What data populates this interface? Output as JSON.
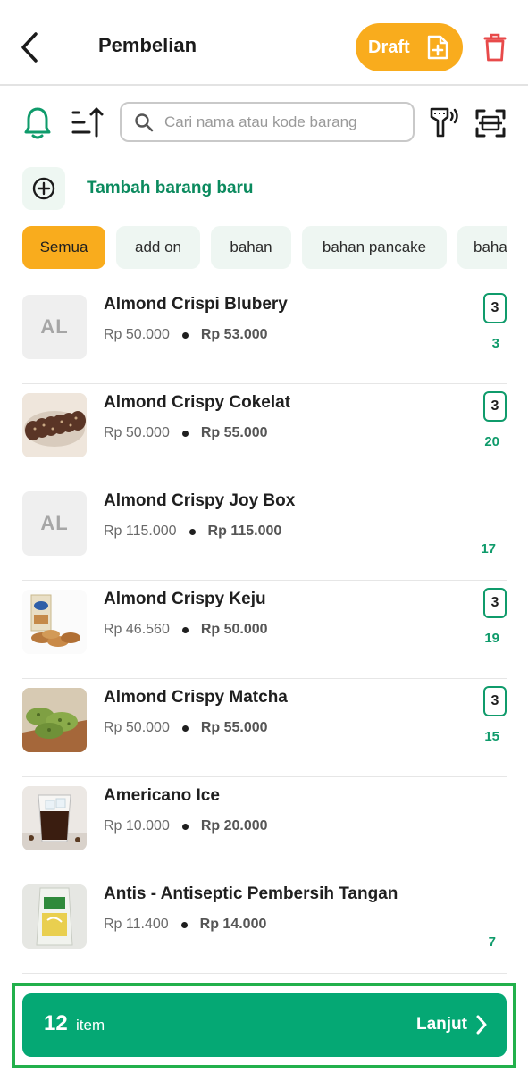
{
  "header": {
    "title": "Pembelian",
    "draft_label": "Draft",
    "accent": "#f9ac1d",
    "danger": "#e84a4a"
  },
  "toolbar": {
    "search_placeholder": "Cari nama atau kode barang"
  },
  "add_item": {
    "label": "Tambah barang baru"
  },
  "categories": [
    {
      "label": "Semua",
      "active": true
    },
    {
      "label": "add on",
      "active": false
    },
    {
      "label": "bahan",
      "active": false
    },
    {
      "label": "bahan pancake",
      "active": false
    },
    {
      "label": "baha",
      "active": false
    }
  ],
  "products": [
    {
      "name": "Almond Crispi Blubery",
      "initials": "AL",
      "buy_price": "Rp 50.000",
      "sell_price": "Rp 53.000",
      "qty": "3",
      "stock": "3",
      "image": "initials"
    },
    {
      "name": "Almond Crispy Cokelat",
      "buy_price": "Rp 50.000",
      "sell_price": "Rp 55.000",
      "qty": "3",
      "stock": "20",
      "image": "cookies-photo"
    },
    {
      "name": "Almond Crispy Joy Box",
      "initials": "AL",
      "buy_price": "Rp 115.000",
      "sell_price": "Rp 115.000",
      "qty": null,
      "stock": "17",
      "image": "initials"
    },
    {
      "name": "Almond Crispy Keju",
      "buy_price": "Rp 46.560",
      "sell_price": "Rp 50.000",
      "qty": "3",
      "stock": "19",
      "image": "box-photo"
    },
    {
      "name": "Almond Crispy Matcha",
      "buy_price": "Rp 50.000",
      "sell_price": "Rp 55.000",
      "qty": "3",
      "stock": "15",
      "image": "matcha-photo"
    },
    {
      "name": "Americano Ice",
      "buy_price": "Rp 10.000",
      "sell_price": "Rp 20.000",
      "qty": null,
      "stock": "",
      "image": "coffee-photo"
    },
    {
      "name": "Antis - Antiseptic Pembersih Tangan",
      "buy_price": "Rp 11.400",
      "sell_price": "Rp 14.000",
      "qty": null,
      "stock": "7",
      "image": "sanitizer-photo"
    }
  ],
  "footer": {
    "count": "12",
    "unit": "item",
    "next_label": "Lanjut",
    "color": "#05a874"
  }
}
